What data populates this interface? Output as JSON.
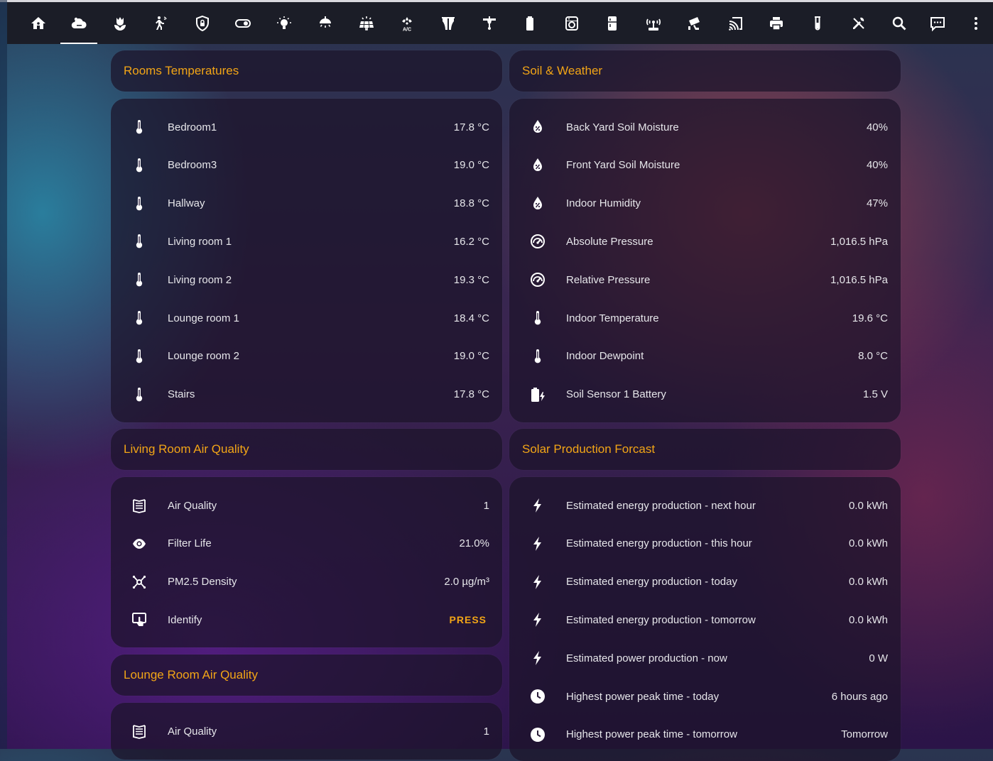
{
  "toolbar": {
    "tabs": [
      {
        "icon": "home-icon"
      },
      {
        "icon": "weather-cloud-icon",
        "active": true
      },
      {
        "icon": "flower-icon"
      },
      {
        "icon": "motion-sensor-icon"
      },
      {
        "icon": "shield-lock-icon"
      },
      {
        "icon": "toggle-switch-icon"
      },
      {
        "icon": "lightbulb-icon"
      },
      {
        "icon": "ceiling-light-icon"
      },
      {
        "icon": "solar-panel-icon"
      },
      {
        "icon": "air-conditioner-icon",
        "text": "A/C"
      },
      {
        "icon": "window-shutter-icon"
      },
      {
        "icon": "ceiling-fan-icon"
      },
      {
        "icon": "battery-icon"
      },
      {
        "icon": "washing-machine-icon"
      },
      {
        "icon": "fridge-icon"
      },
      {
        "icon": "router-wireless-icon"
      },
      {
        "icon": "cctv-icon"
      },
      {
        "icon": "cast-icon"
      },
      {
        "icon": "printer-icon"
      },
      {
        "icon": "test-tube-icon"
      },
      {
        "icon": "tools-icon"
      },
      {
        "icon": "search-icon"
      },
      {
        "icon": "chat-message-icon"
      },
      {
        "icon": "more-vertical-icon"
      }
    ]
  },
  "colors": {
    "accent": "#f2a516",
    "toolbar_bg": "#1b1d27",
    "card_bg": "#1c142a"
  },
  "rooms_temperatures": {
    "title": "Rooms Temperatures",
    "rows": [
      {
        "icon": "thermometer-icon",
        "name": "Bedroom1",
        "value": "17.8 °C"
      },
      {
        "icon": "thermometer-icon",
        "name": "Bedroom3",
        "value": "19.0 °C"
      },
      {
        "icon": "thermometer-icon",
        "name": "Hallway",
        "value": "18.8 °C"
      },
      {
        "icon": "thermometer-icon",
        "name": "Living room 1",
        "value": "16.2 °C"
      },
      {
        "icon": "thermometer-icon",
        "name": "Living room 2",
        "value": "19.3 °C"
      },
      {
        "icon": "thermometer-icon",
        "name": "Lounge room 1",
        "value": "18.4 °C"
      },
      {
        "icon": "thermometer-icon",
        "name": "Lounge room 2",
        "value": "19.0 °C"
      },
      {
        "icon": "thermometer-icon",
        "name": "Stairs",
        "value": "17.8 °C"
      }
    ]
  },
  "soil_weather": {
    "title": "Soil & Weather",
    "rows": [
      {
        "icon": "water-percent-icon",
        "name": "Back Yard Soil Moisture",
        "value": "40%"
      },
      {
        "icon": "water-percent-icon",
        "name": "Front Yard Soil Moisture",
        "value": "40%"
      },
      {
        "icon": "water-percent-icon",
        "name": "Indoor Humidity",
        "value": "47%"
      },
      {
        "icon": "gauge-icon",
        "name": "Absolute Pressure",
        "value": "1,016.5 hPa"
      },
      {
        "icon": "gauge-icon",
        "name": "Relative Pressure",
        "value": "1,016.5 hPa"
      },
      {
        "icon": "thermometer-icon",
        "name": "Indoor Temperature",
        "value": "19.6 °C"
      },
      {
        "icon": "thermometer-icon",
        "name": "Indoor Dewpoint",
        "value": "8.0 °C"
      },
      {
        "icon": "battery-charging-icon",
        "name": "Soil Sensor 1 Battery",
        "value": "1.5 V"
      }
    ]
  },
  "living_air": {
    "title": "Living Room Air Quality",
    "rows": [
      {
        "icon": "air-filter-icon",
        "name": "Air Quality",
        "value": "1"
      },
      {
        "icon": "eye-icon",
        "name": "Filter Life",
        "value": "21.0%"
      },
      {
        "icon": "molecule-icon",
        "name": "PM2.5 Density",
        "value": "2.0 µg/m³"
      },
      {
        "icon": "gesture-tap-icon",
        "name": "Identify",
        "action": "PRESS"
      }
    ]
  },
  "lounge_air": {
    "title": "Lounge Room Air Quality",
    "rows": [
      {
        "icon": "air-filter-icon",
        "name": "Air Quality",
        "value": "1"
      }
    ]
  },
  "solar": {
    "title": "Solar Production Forcast",
    "rows": [
      {
        "icon": "flash-icon",
        "name": "Estimated energy production - next hour",
        "value": "0.0 kWh"
      },
      {
        "icon": "flash-icon",
        "name": "Estimated energy production - this hour",
        "value": "0.0 kWh"
      },
      {
        "icon": "flash-icon",
        "name": "Estimated energy production - today",
        "value": "0.0 kWh"
      },
      {
        "icon": "flash-icon",
        "name": "Estimated energy production - tomorrow",
        "value": "0.0 kWh"
      },
      {
        "icon": "flash-icon",
        "name": "Estimated power production - now",
        "value": "0 W"
      },
      {
        "icon": "clock-icon",
        "name": "Highest power peak time - today",
        "value": "6 hours ago"
      },
      {
        "icon": "clock-icon",
        "name": "Highest power peak time - tomorrow",
        "value": "Tomorrow"
      }
    ]
  }
}
